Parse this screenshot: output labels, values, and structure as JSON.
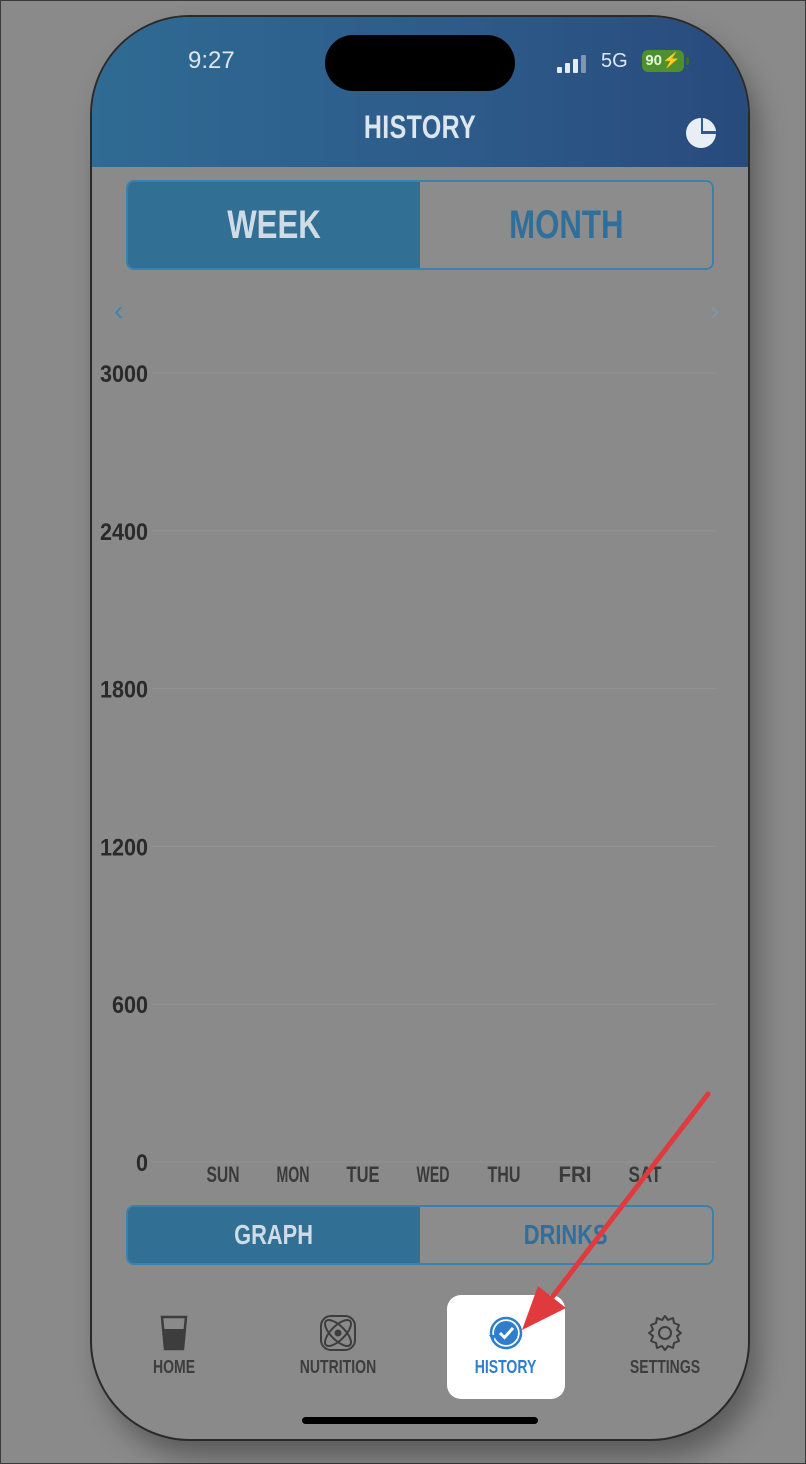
{
  "status": {
    "time": "9:27",
    "network": "5G",
    "battery": "90"
  },
  "header": {
    "title": "HISTORY",
    "pie_icon": "pie-chart-icon"
  },
  "range_toggle": {
    "week": "WEEK",
    "month": "MONTH",
    "selected": "WEEK"
  },
  "view_toggle": {
    "graph": "GRAPH",
    "drinks": "DRINKS",
    "selected": "GRAPH"
  },
  "nav": {
    "prev": "‹",
    "next": "›"
  },
  "chart_data": {
    "type": "bar",
    "categories": [
      "SUN",
      "MON",
      "TUE",
      "WED",
      "THU",
      "FRI",
      "SAT"
    ],
    "values": [
      0,
      0,
      0,
      0,
      0,
      0,
      0
    ],
    "yticks": [
      "3000",
      "2400",
      "1800",
      "1200",
      "600",
      "0"
    ],
    "ylim": [
      0,
      3000
    ],
    "grid": true
  },
  "tabbar": {
    "items": [
      {
        "label": "HOME",
        "icon": "cup-icon"
      },
      {
        "label": "NUTRITION",
        "icon": "atom-icon"
      },
      {
        "label": "HISTORY",
        "icon": "history-icon",
        "active": true
      },
      {
        "label": "SETTINGS",
        "icon": "gear-icon"
      }
    ]
  },
  "colors": {
    "accent": "#316f95",
    "header_start": "#2f6b93",
    "header_end": "#284a7c",
    "annotation_arrow": "#e03a3e"
  }
}
